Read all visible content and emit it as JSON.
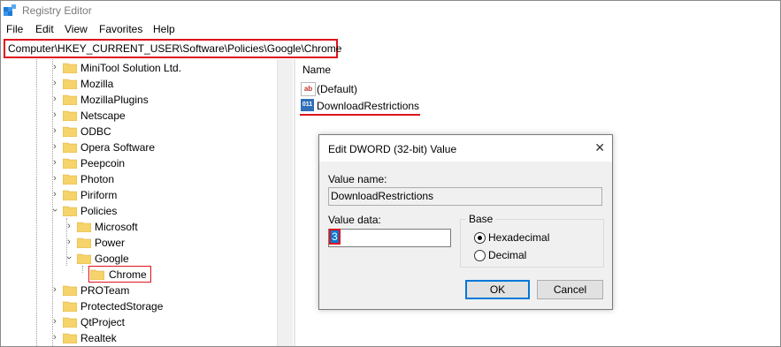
{
  "window": {
    "title": "Registry Editor"
  },
  "menu": [
    "File",
    "Edit",
    "View",
    "Favorites",
    "Help"
  ],
  "address_bar": {
    "path": "Computer\\HKEY_CURRENT_USER\\Software\\Policies\\Google\\Chrome"
  },
  "tree": {
    "items": [
      {
        "label": "MiniTool Solution Ltd."
      },
      {
        "label": "Mozilla"
      },
      {
        "label": "MozillaPlugins"
      },
      {
        "label": "Netscape"
      },
      {
        "label": "ODBC"
      },
      {
        "label": "Opera Software"
      },
      {
        "label": "Peepcoin"
      },
      {
        "label": "Photon"
      },
      {
        "label": "Piriform"
      },
      {
        "label": "Policies"
      },
      {
        "label": "Microsoft"
      },
      {
        "label": "Power"
      },
      {
        "label": "Google"
      },
      {
        "label": "Chrome"
      },
      {
        "label": "PROTeam"
      },
      {
        "label": "ProtectedStorage"
      },
      {
        "label": "QtProject"
      },
      {
        "label": "Realtek"
      }
    ]
  },
  "values_pane": {
    "column_name": "Name",
    "values": [
      {
        "icon": "string-value-icon",
        "icon_text": "ab",
        "name": "(Default)"
      },
      {
        "icon": "dword-value-icon",
        "icon_text": "011",
        "name": "DownloadRestrictions"
      }
    ]
  },
  "dialog": {
    "title": "Edit DWORD (32-bit) Value",
    "close_glyph": "✕",
    "value_name_label": "Value name:",
    "value_name": "DownloadRestrictions",
    "value_data_label": "Value data:",
    "value_data": "3",
    "base_label": "Base",
    "base_options": [
      "Hexadecimal",
      "Decimal"
    ],
    "base_selected": "Hexadecimal",
    "ok_label": "OK",
    "cancel_label": "Cancel"
  },
  "colors": {
    "highlight_red": "#e0131b",
    "folder_yellow": "#f6d36b",
    "accent_blue": "#0078d7"
  }
}
